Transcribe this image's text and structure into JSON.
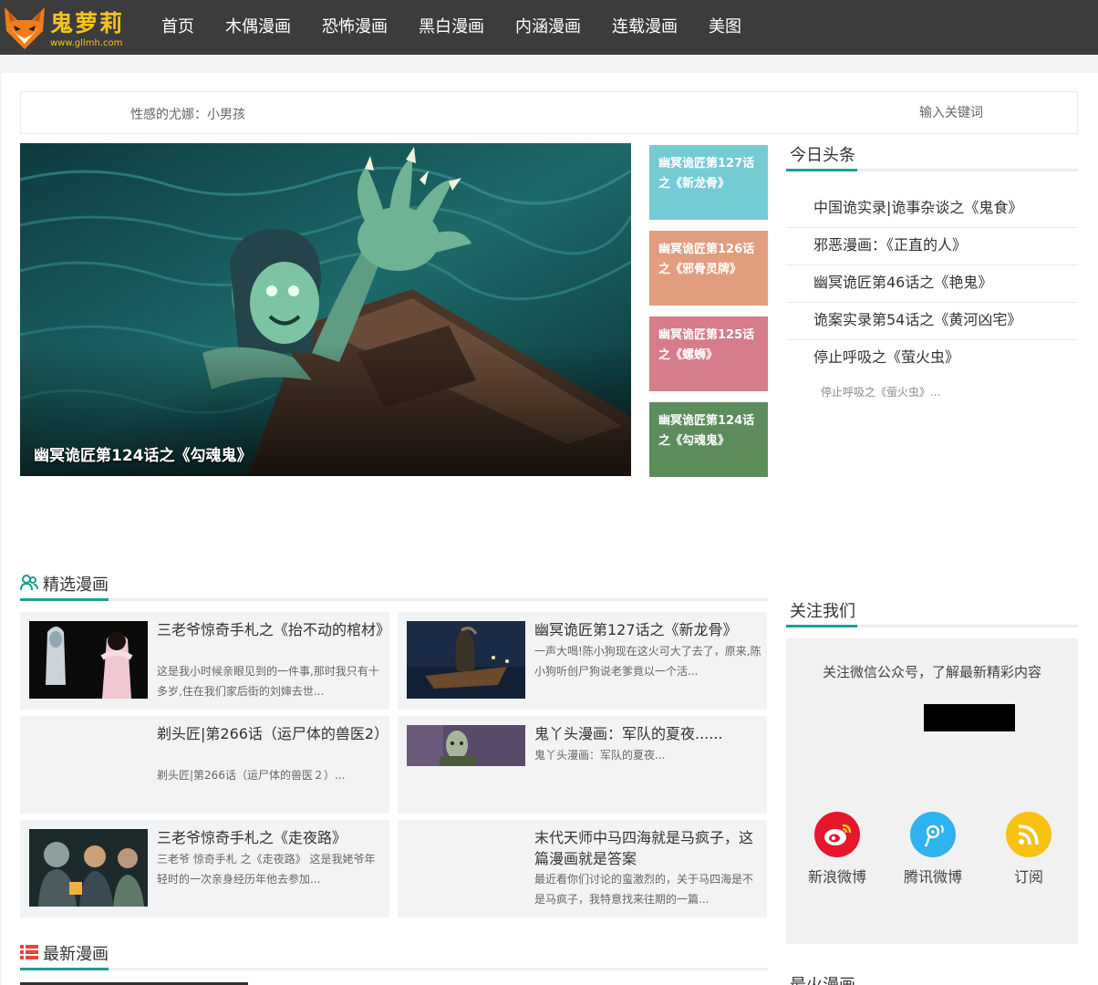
{
  "header": {
    "logo_title": "鬼萝莉",
    "logo_url": "www.gllmh.com",
    "nav": [
      "首页",
      "木偶漫画",
      "恐怖漫画",
      "黑白漫画",
      "内涵漫画",
      "连载漫画",
      "美图"
    ]
  },
  "notice": {
    "text": "性感的尤娜：小男孩"
  },
  "search": {
    "placeholder": "输入关键词"
  },
  "hero": {
    "caption": "幽冥诡匠第124话之《勾魂鬼》"
  },
  "side_tiles": [
    {
      "title": "幽冥诡匠第127话之《新龙骨》",
      "color": "#74cbd3"
    },
    {
      "title": "幽冥诡匠第126话之《邪骨灵牌》",
      "color": "#e19d7d"
    },
    {
      "title": "幽冥诡匠第125话之《螺蛳》",
      "color": "#d57d8a"
    },
    {
      "title": "幽冥诡匠第124话之《勾魂鬼》",
      "color": "#5c8d5b"
    }
  ],
  "today": {
    "title": "今日头条",
    "items": [
      "中国诡实录|诡事杂谈之《鬼食》",
      "邪恶漫画：《正直的人》",
      "幽冥诡匠第46话之《艳鬼》",
      "诡案实录第54话之《黄河凶宅》",
      "停止呼吸之《萤火虫》"
    ],
    "last_summary": "停止呼吸之《萤火虫》..."
  },
  "featured": {
    "title": "精选漫画",
    "cards": [
      {
        "title": "三老爷惊奇手札之《抬不动的棺材》",
        "desc": "这是我小时候亲眼见到的一件事,那时我只有十多岁,住在我们家后街的刘婶去世..."
      },
      {
        "title": "幽冥诡匠第127话之《新龙骨》",
        "desc": "一声大喝!陈小狗现在这火可大了去了，原来,陈小狗听创尸狗说老爹竟以一个活..."
      },
      {
        "title": "剃头匠|第266话（运尸体的兽医2）",
        "desc": "剃头匠|第266话（运尸体的兽医２）..."
      },
      {
        "title": "鬼丫头漫画：军队的夏夜......",
        "desc": "鬼丫头漫画：军队的夏夜..."
      },
      {
        "title": "三老爷惊奇手札之《走夜路》",
        "desc": "三老爷 惊奇手札 之《走夜路》 这是我姥爷年轻时的一次亲身经历年他去参加..."
      },
      {
        "title": "末代天师中马四海就是马疯子，这篇漫画就是答案",
        "desc": "最近看你们讨论的蛮激烈的，关于马四海是不是马疯子，我特意找来往期的一篇..."
      }
    ]
  },
  "latest": {
    "title": "最新漫画"
  },
  "follow": {
    "title": "关注我们",
    "text": "关注微信公众号，了解最新精彩内容",
    "socials": [
      "新浪微博",
      "腾讯微博",
      "订阅"
    ]
  },
  "hot": {
    "title": "最火漫画"
  },
  "colors": {
    "header_bg": "#3c3c3c",
    "logo_yellow": "#f3c51c",
    "accent_teal": "#1a9e92",
    "card_bg": "#f1f3f5",
    "weibo_red": "#e6162d",
    "tencent_blue": "#2fb2f0",
    "rss_yellow": "#f7c212"
  },
  "icons": [
    "fox-logo-icon",
    "users-icon",
    "list-icon",
    "weibo-icon",
    "tencent-weibo-icon",
    "rss-icon"
  ]
}
